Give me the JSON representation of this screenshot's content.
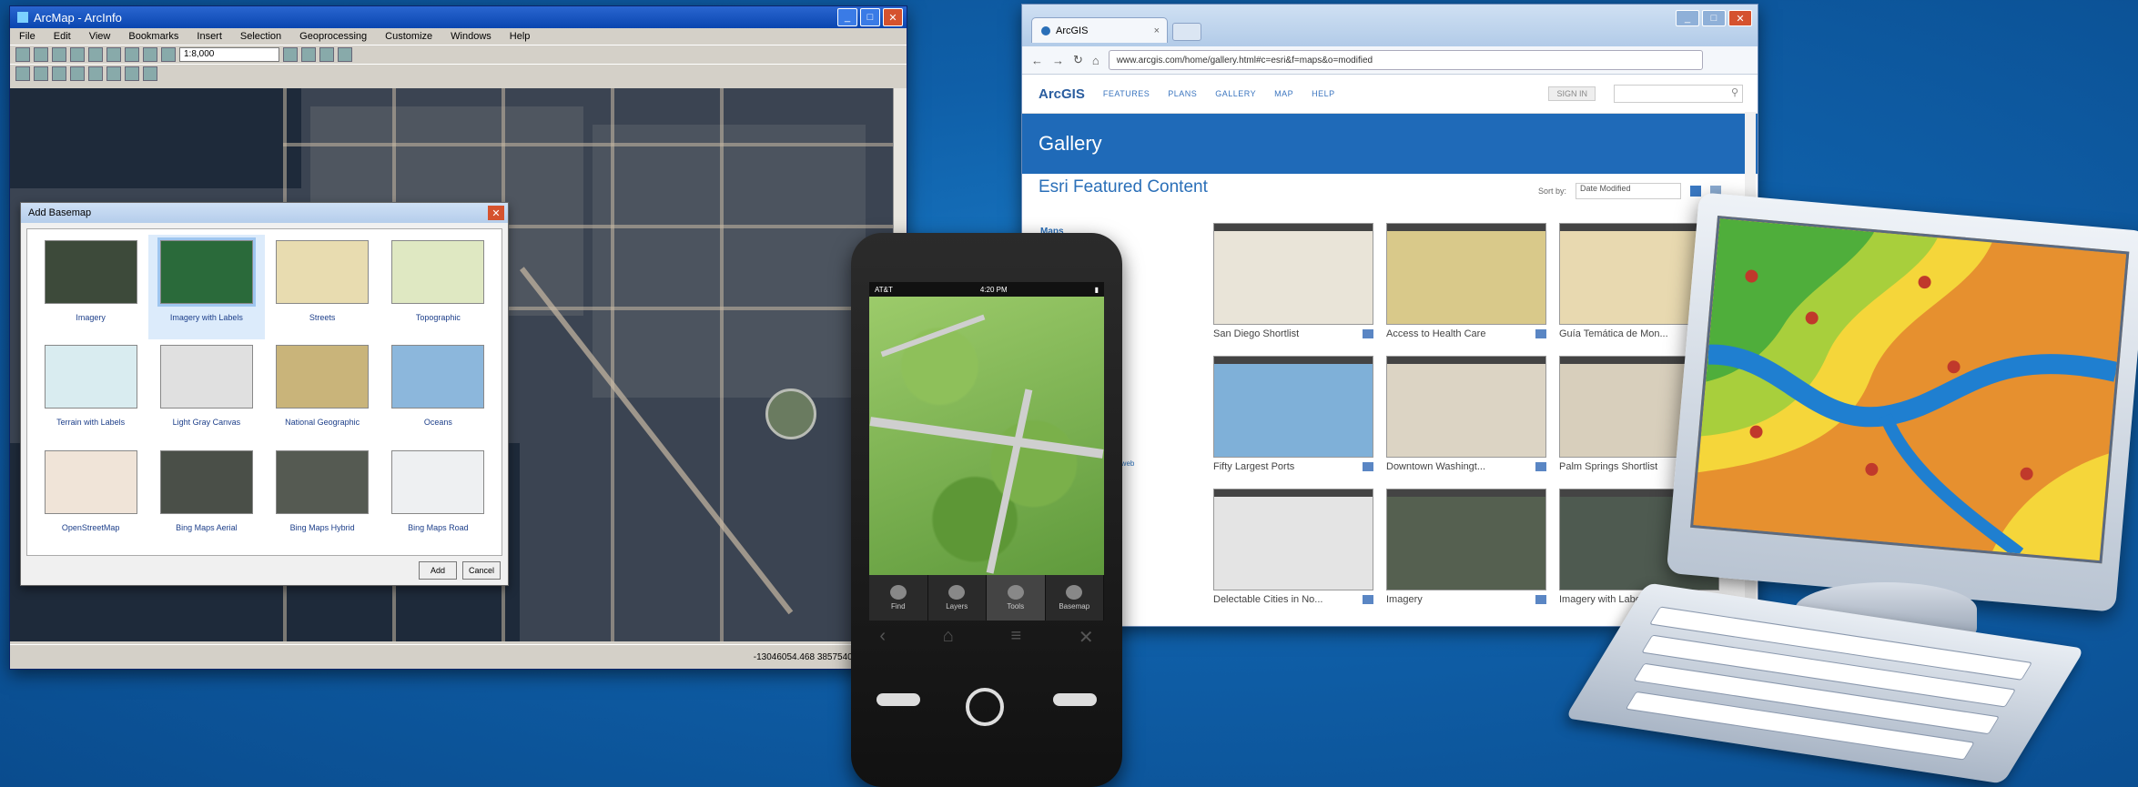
{
  "desktop": {
    "title": "ArcMap - ArcInfo",
    "menu": [
      "File",
      "Edit",
      "View",
      "Bookmarks",
      "Insert",
      "Selection",
      "Geoprocessing",
      "Customize",
      "Windows",
      "Help"
    ],
    "scale": "1:8,000",
    "status_coords": "-13046054.468  3857540.44 Meters",
    "dialog": {
      "title": "Add Basemap",
      "items": [
        {
          "label": "Imagery",
          "color": "#3d4a3a"
        },
        {
          "label": "Imagery with Labels",
          "color": "#2a6a3a"
        },
        {
          "label": "Streets",
          "color": "#e8dcb0"
        },
        {
          "label": "Topographic",
          "color": "#dfe8c2"
        },
        {
          "label": "Terrain with Labels",
          "color": "#d9ecf0"
        },
        {
          "label": "Light Gray Canvas",
          "color": "#e0e0e0"
        },
        {
          "label": "National Geographic",
          "color": "#c9b47a"
        },
        {
          "label": "Oceans",
          "color": "#8cb7dc"
        },
        {
          "label": "OpenStreetMap",
          "color": "#f0e4d8"
        },
        {
          "label": "Bing Maps Aerial",
          "color": "#4a4f48"
        },
        {
          "label": "Bing Maps Hybrid",
          "color": "#555a52"
        },
        {
          "label": "Bing Maps Road",
          "color": "#eef0f2"
        }
      ],
      "add_label": "Add",
      "cancel_label": "Cancel"
    }
  },
  "browser": {
    "tab_title": "ArcGIS",
    "url": "www.arcgis.com/home/gallery.html#c=esri&f=maps&o=modified",
    "logo": "ArcGIS",
    "nav": [
      "FEATURES",
      "PLANS",
      "GALLERY",
      "MAP",
      "HELP"
    ],
    "sign_in": "SIGN IN",
    "banner": "Gallery",
    "featured": "Esri Featured Content",
    "sort_label": "Sort by:",
    "sort_value": "Date Modified",
    "side_more": "Maps",
    "side_link": "Show in web",
    "cards": [
      {
        "caption": "San Diego Shortlist",
        "color": "#e9e4d8"
      },
      {
        "caption": "Access to Health Care",
        "color": "#d9c98a"
      },
      {
        "caption": "Guía Temática de Mon...",
        "color": "#e8d9b0"
      },
      {
        "caption": "Fifty Largest Ports",
        "color": "#7fb0d8"
      },
      {
        "caption": "Downtown Washingt...",
        "color": "#dcd4c4"
      },
      {
        "caption": "Palm Springs Shortlist",
        "color": "#d8cfbc"
      },
      {
        "caption": "Delectable Cities in No...",
        "color": "#e4e4e4"
      },
      {
        "caption": "Imagery",
        "color": "#556050"
      },
      {
        "caption": "Imagery with Labels",
        "color": "#4e5a50"
      }
    ]
  },
  "phone": {
    "carrier": "AT&T",
    "time": "4:20 PM",
    "tabs": [
      "Find",
      "Layers",
      "Tools",
      "Basemap"
    ]
  }
}
